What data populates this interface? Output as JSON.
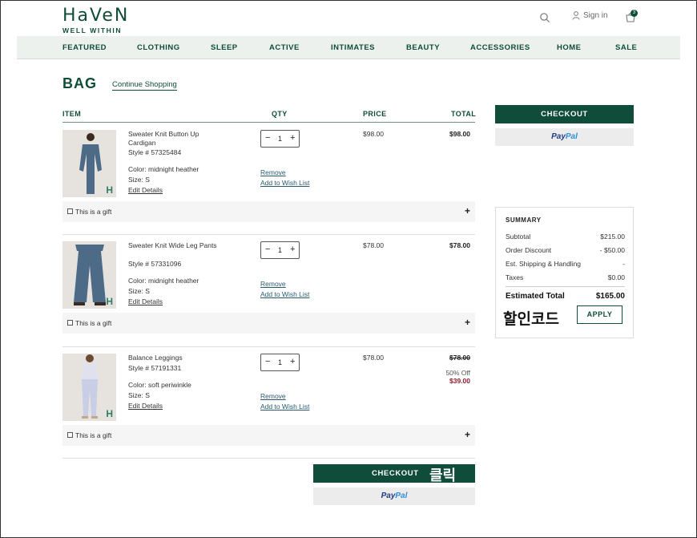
{
  "header": {
    "logo_main": "HaVeN",
    "logo_sub": "WELL WITHIN",
    "signin_label": "Sign in",
    "bag_count": "3"
  },
  "nav": [
    "FEATURED",
    "CLOTHING",
    "SLEEP",
    "ACTIVE",
    "INTIMATES",
    "BEAUTY",
    "ACCESSORIES",
    "HOME",
    "SALE"
  ],
  "bag": {
    "title": "BAG",
    "continue_label": "Continue Shopping"
  },
  "columns": {
    "item": "ITEM",
    "qty": "QTY",
    "price": "PRICE",
    "total": "TOTAL"
  },
  "items": [
    {
      "name": "Sweater Knit Button Up Cardigan",
      "style": "Style # 57325484",
      "color": "Color: midnight heather",
      "size": "Size: S",
      "edit": "Edit Details",
      "qty": "1",
      "remove": "Remove",
      "wishlist": "Add to Wish List",
      "price": "$98.00",
      "total": "$98.00",
      "gift": "This is a gift"
    },
    {
      "name": "Sweater Knit Wide Leg Pants",
      "style": "Style # 57331096",
      "color": "Color: midnight heather",
      "size": "Size: S",
      "edit": "Edit Details",
      "qty": "1",
      "remove": "Remove",
      "wishlist": "Add to Wish List",
      "price": "$78.00",
      "total": "$78.00",
      "gift": "This is a gift"
    },
    {
      "name": "Balance Leggings",
      "style": "Style # 57191331",
      "color": "Color: soft periwinkle",
      "size": "Size: S",
      "edit": "Edit Details",
      "qty": "1",
      "remove": "Remove",
      "wishlist": "Add to Wish List",
      "price": "$78.00",
      "total": "$78.00",
      "discount": "50% Off",
      "sale_total": "$39.00",
      "gift": "This is a gift"
    }
  ],
  "checkout_label": "CHECKOUT",
  "paypal": {
    "part1": "Pay",
    "part2": "Pal"
  },
  "summary": {
    "title": "SUMMARY",
    "rows": [
      {
        "label": "Subtotal",
        "value": "$215.00"
      },
      {
        "label": "Order Discount",
        "value": "- $50.00"
      },
      {
        "label": "Est. Shipping & Handling",
        "value": "-"
      },
      {
        "label": "Taxes",
        "value": "$0.00"
      }
    ],
    "estimated_label": "Estimated Total",
    "estimated_value": "$165.00",
    "promo_annotation": "할인코드",
    "apply_label": "APPLY"
  },
  "click_annotation": "클릭",
  "colors": {
    "brand": "#0f4c3a",
    "sale": "#8b1e2e"
  }
}
